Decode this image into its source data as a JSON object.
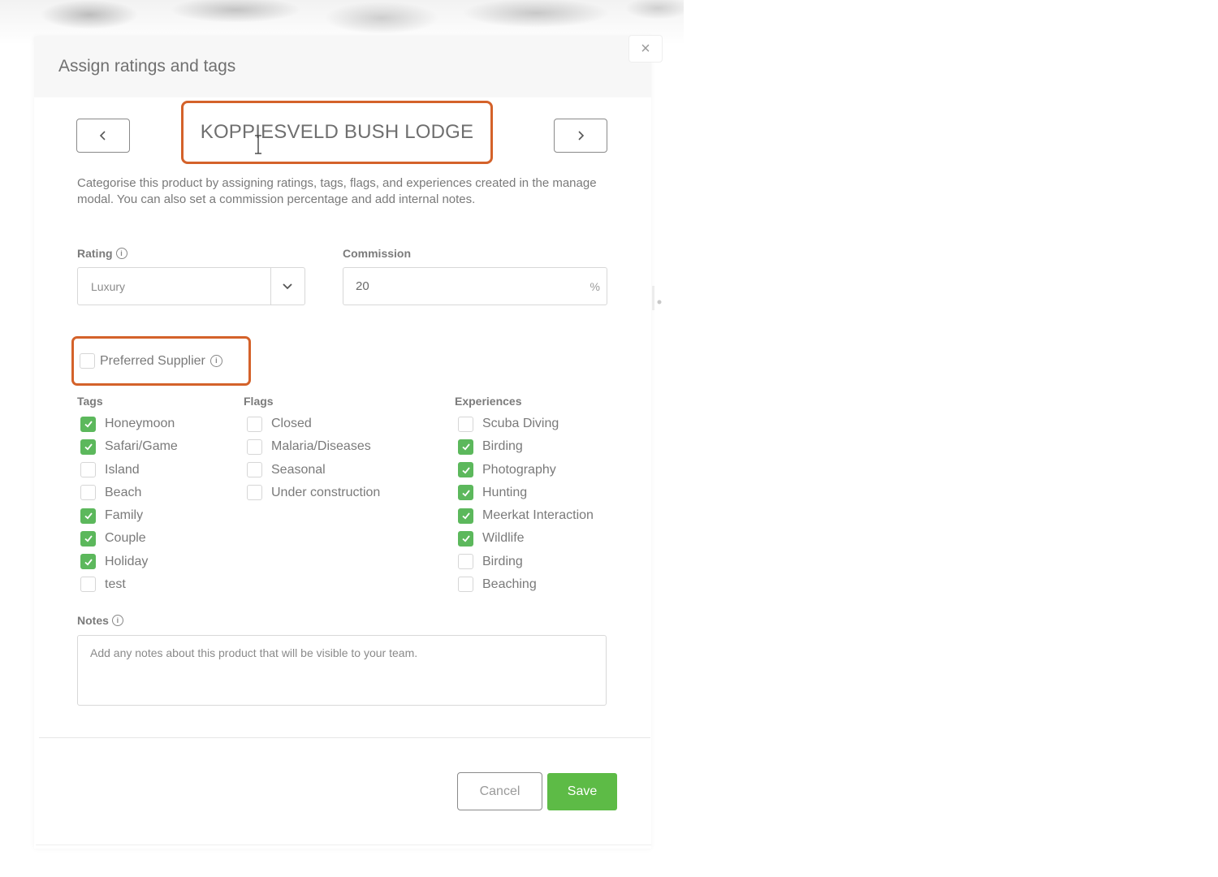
{
  "modal": {
    "title": "Assign ratings and tags",
    "close_label": "×",
    "product_name": "KOPPIESVELD BUSH LODGE",
    "description": "Categorise this product by assigning ratings, tags, flags, and experiences created in the manage modal. You can also set a commission percentage and add internal notes."
  },
  "rating": {
    "label": "Rating",
    "value": "Luxury"
  },
  "commission": {
    "label": "Commission",
    "value": "20",
    "unit": "%"
  },
  "preferred_supplier": {
    "label": "Preferred Supplier",
    "checked": false
  },
  "tags": {
    "title": "Tags",
    "items": [
      {
        "label": "Honeymoon",
        "checked": true
      },
      {
        "label": "Safari/Game",
        "checked": true
      },
      {
        "label": "Island",
        "checked": false
      },
      {
        "label": "Beach",
        "checked": false
      },
      {
        "label": "Family",
        "checked": true
      },
      {
        "label": "Couple",
        "checked": true
      },
      {
        "label": "Holiday",
        "checked": true
      },
      {
        "label": "test",
        "checked": false
      }
    ]
  },
  "flags": {
    "title": "Flags",
    "items": [
      {
        "label": "Closed",
        "checked": false
      },
      {
        "label": "Malaria/Diseases",
        "checked": false
      },
      {
        "label": "Seasonal",
        "checked": false
      },
      {
        "label": "Under construction",
        "checked": false
      }
    ]
  },
  "experiences": {
    "title": "Experiences",
    "items": [
      {
        "label": "Scuba Diving",
        "checked": false
      },
      {
        "label": "Birding",
        "checked": true
      },
      {
        "label": "Photography",
        "checked": true
      },
      {
        "label": "Hunting",
        "checked": true
      },
      {
        "label": "Meerkat Interaction",
        "checked": true
      },
      {
        "label": "Wildlife",
        "checked": true
      },
      {
        "label": "Birding",
        "checked": false
      },
      {
        "label": "Beaching",
        "checked": false
      }
    ]
  },
  "notes": {
    "label": "Notes",
    "placeholder": "Add any notes about this product that will be visible to your team."
  },
  "buttons": {
    "cancel": "Cancel",
    "save": "Save"
  },
  "colors": {
    "accent_green": "#5cb85c",
    "save_green": "#5dbb46",
    "highlight_orange": "#d4622a"
  }
}
